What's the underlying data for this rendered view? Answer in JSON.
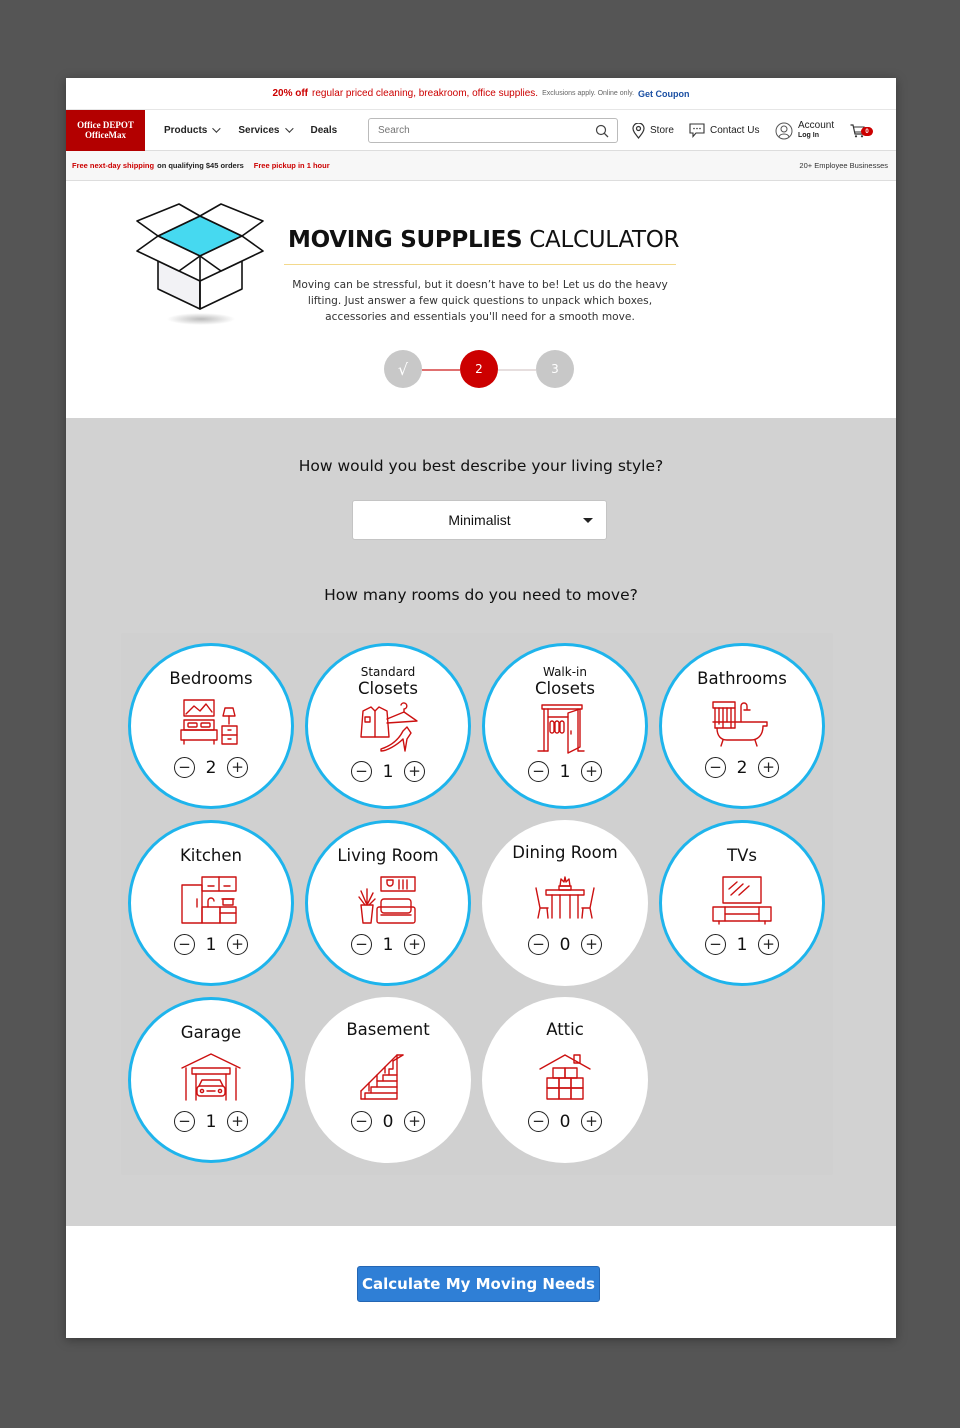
{
  "promo": {
    "headline": "20% off",
    "text": "regular priced cleaning, breakroom, office supplies.",
    "fine_print": "Exclusions apply. Online only.",
    "link": "Get Coupon"
  },
  "header": {
    "logo_line1": "Office DEPOT",
    "logo_line2": "OfficeMax",
    "nav": [
      {
        "label": "Products",
        "has_dropdown": true
      },
      {
        "label": "Services",
        "has_dropdown": true
      },
      {
        "label": "Deals",
        "has_dropdown": false
      }
    ],
    "search": {
      "placeholder": "Search",
      "value": ""
    },
    "store_label": "Store",
    "contact_label": "Contact Us",
    "account_label": "Account",
    "login_label": "Log In",
    "cart_count": "0"
  },
  "subbar": {
    "shipping_highlight": "Free next-day shipping",
    "shipping_rest": "on qualifying $45 orders",
    "pickup": "Free pickup in 1 hour",
    "right_link": "20+ Employee Businesses"
  },
  "hero": {
    "title_bold": "MOVING SUPPLIES",
    "title_light": "CALCULATOR",
    "description": "Moving can be stressful, but it doesn’t have to be! Let us do the heavy lifting. Just answer a few quick questions to unpack which boxes, accessories and essentials you'll need for a smooth move."
  },
  "stepper": {
    "steps": [
      {
        "label": "√",
        "state": "done"
      },
      {
        "label": "2",
        "state": "current"
      },
      {
        "label": "3",
        "state": "upcoming"
      }
    ]
  },
  "quiz": {
    "living_style_question": "How would you best describe your living style?",
    "living_style_value": "Minimalist",
    "rooms_question": "How many rooms do you need to move?",
    "rooms": [
      {
        "label": "Bedrooms",
        "sublabel": "",
        "icon": "bedroom-icon",
        "count": 2,
        "active": true
      },
      {
        "label": "Closets",
        "sublabel": "Standard",
        "icon": "closet-clothes-icon",
        "count": 1,
        "active": true
      },
      {
        "label": "Closets",
        "sublabel": "Walk-in",
        "icon": "walk-in-closet-icon",
        "count": 1,
        "active": true
      },
      {
        "label": "Bathrooms",
        "sublabel": "",
        "icon": "bathtub-icon",
        "count": 2,
        "active": true
      },
      {
        "label": "Kitchen",
        "sublabel": "",
        "icon": "kitchen-icon",
        "count": 1,
        "active": true
      },
      {
        "label": "Living Room",
        "sublabel": "",
        "icon": "living-room-icon",
        "count": 1,
        "active": true
      },
      {
        "label": "Dining Room",
        "sublabel": "",
        "icon": "dining-table-icon",
        "count": 0,
        "active": false
      },
      {
        "label": "TVs",
        "sublabel": "",
        "icon": "tv-icon",
        "count": 1,
        "active": true
      },
      {
        "label": "Garage",
        "sublabel": "",
        "icon": "garage-icon",
        "count": 1,
        "active": true
      },
      {
        "label": "Basement",
        "sublabel": "",
        "icon": "stairs-icon",
        "count": 0,
        "active": false
      },
      {
        "label": "Attic",
        "sublabel": "",
        "icon": "attic-boxes-icon",
        "count": 0,
        "active": false
      }
    ],
    "minus_symbol": "−",
    "plus_symbol": "+"
  },
  "cta": {
    "label": "Calculate My Moving Needs"
  },
  "colors": {
    "brand_red": "#cc0000",
    "active_ring": "#1eb4ec",
    "cta_blue": "#2f7fd6",
    "icon_red": "#cc1111"
  }
}
